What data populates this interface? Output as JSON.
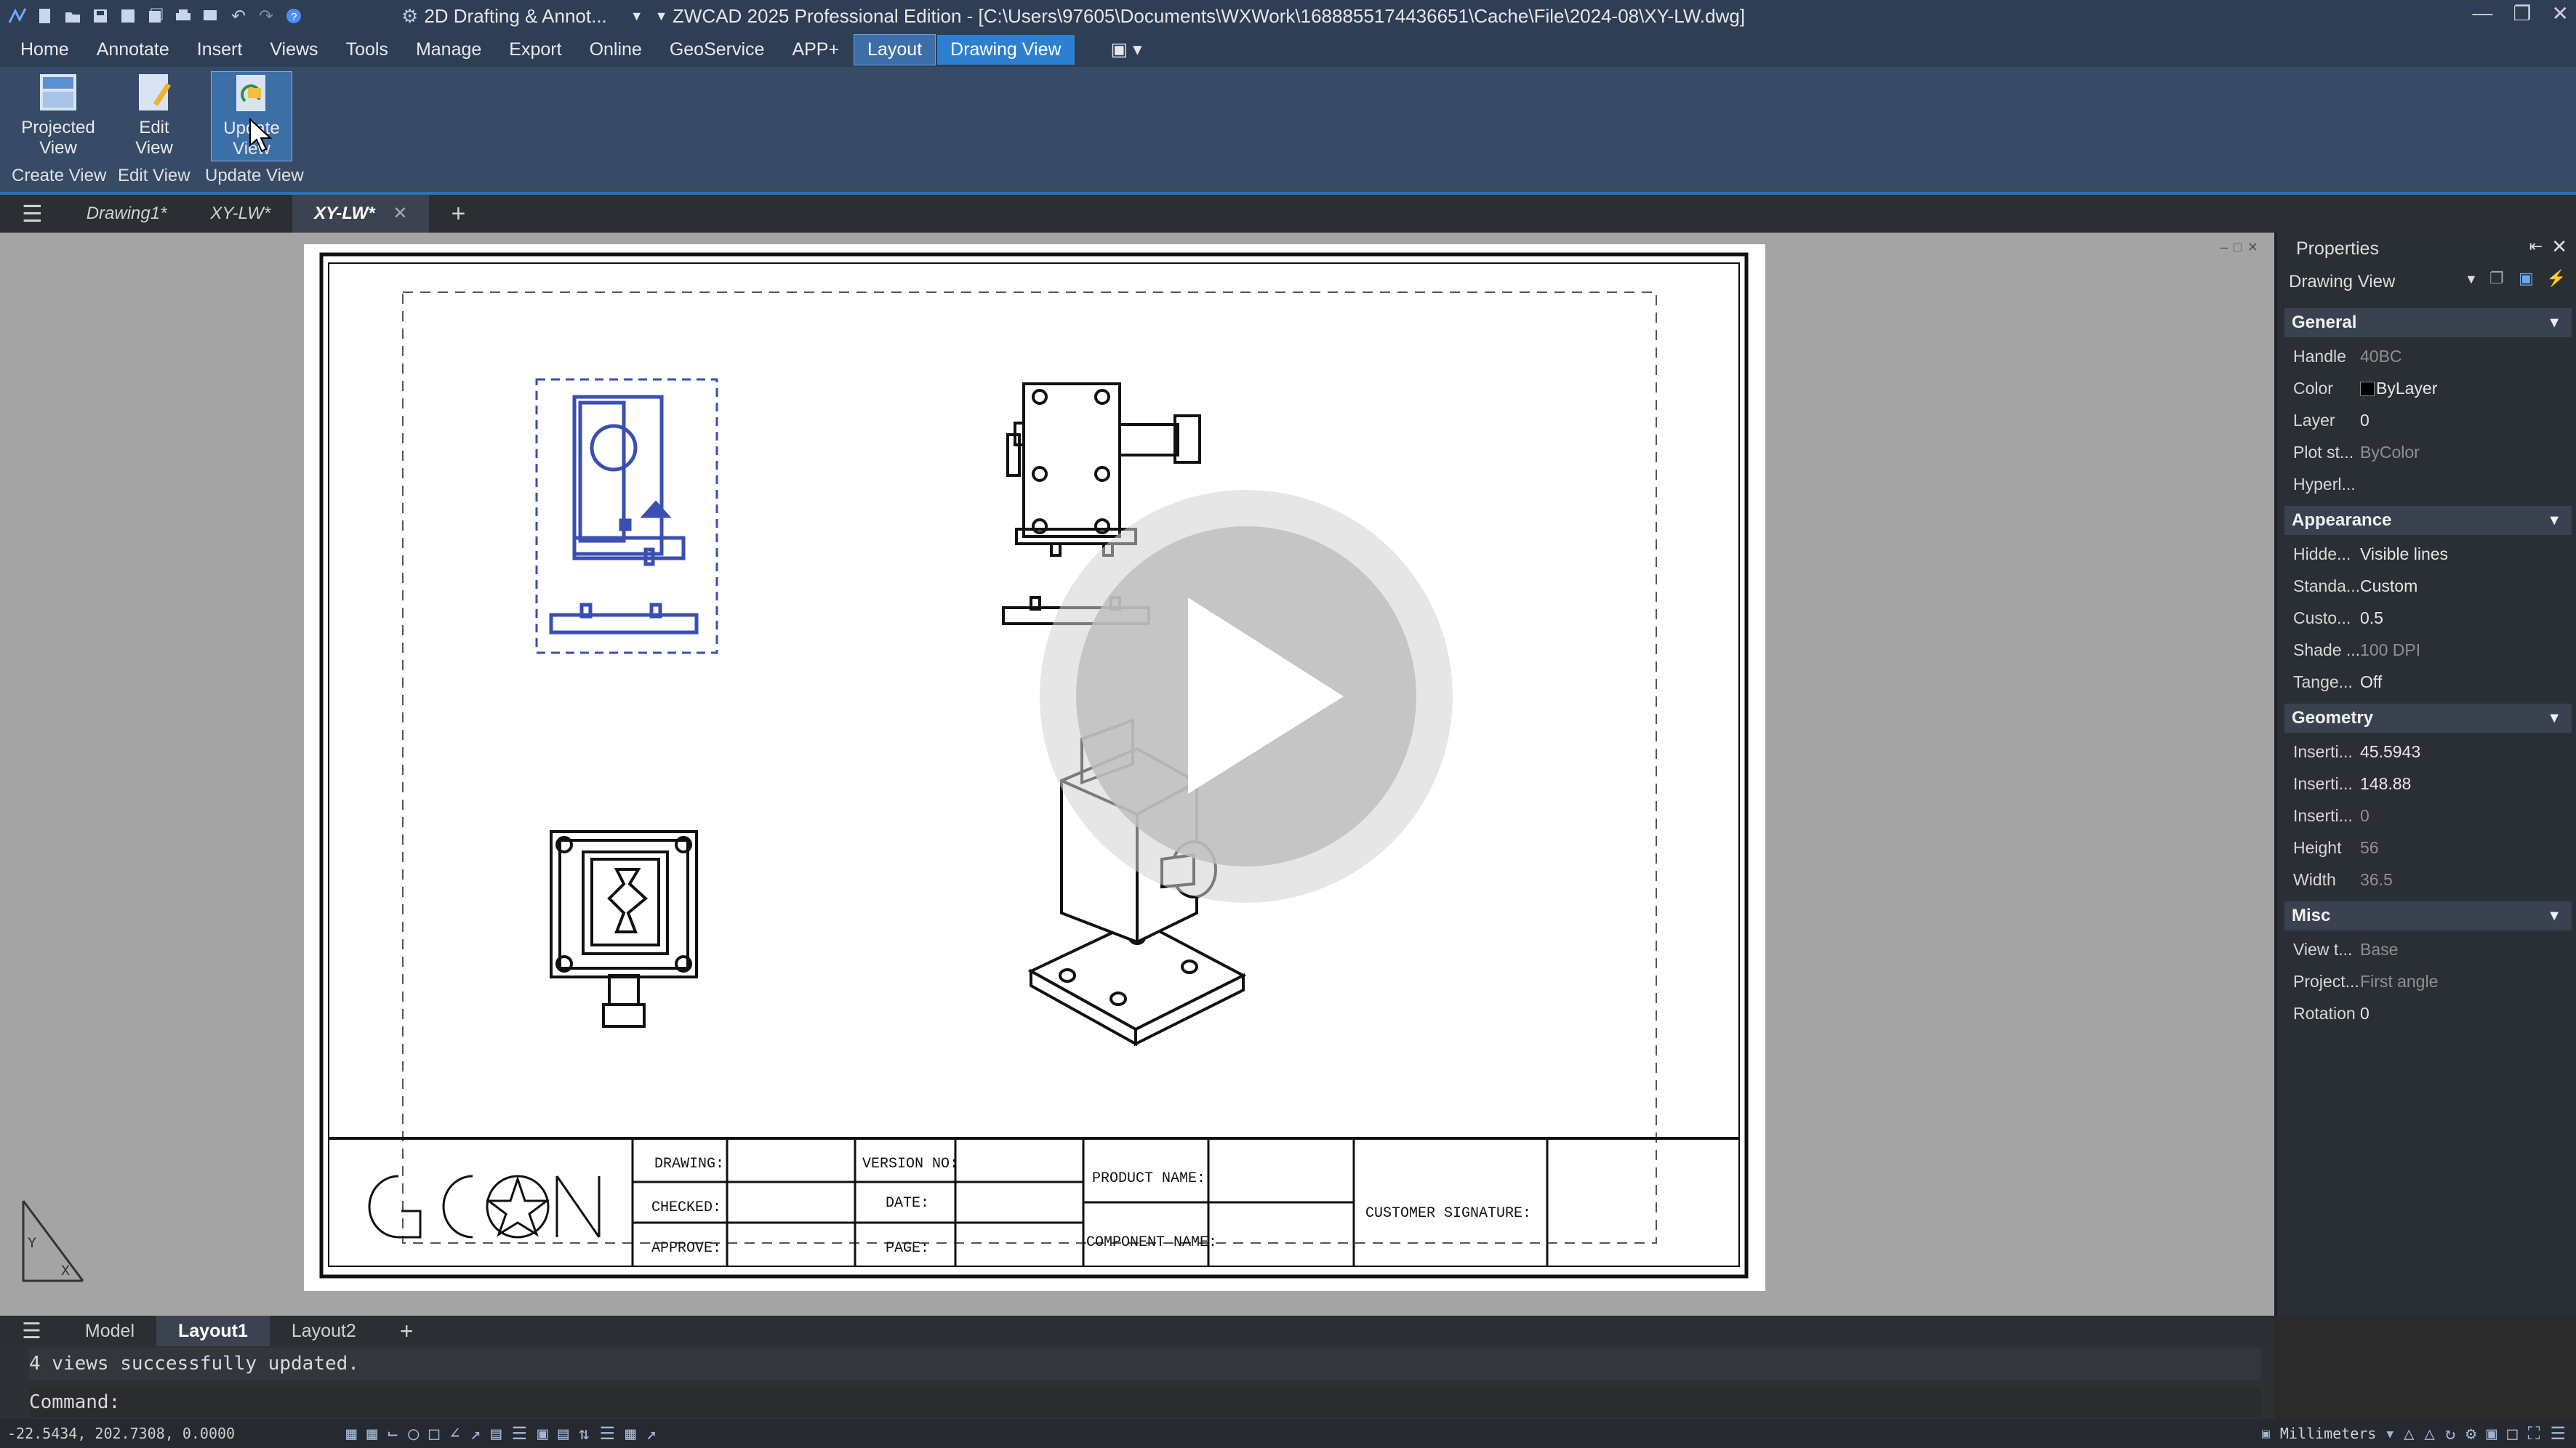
{
  "title_bar": {
    "workspace": "2D Drafting & Annot...",
    "title": "ZWCAD 2025 Professional Edition - [C:\\Users\\97605\\Documents\\WXWork\\1688855174436651\\Cache\\File\\2024-08\\XY-LW.dwg]"
  },
  "menu": [
    "Home",
    "Annotate",
    "Insert",
    "Views",
    "Tools",
    "Manage",
    "Export",
    "Online",
    "GeoService",
    "APP+",
    "Layout",
    "Drawing View"
  ],
  "ribbon": {
    "buttons": [
      {
        "label": "Projected\nView",
        "l1": "Projected",
        "l2": "View"
      },
      {
        "l1": "Edit",
        "l2": "View"
      },
      {
        "l1": "Update",
        "l2": "View"
      }
    ],
    "groups": [
      "Create View",
      "Edit View",
      "Update View"
    ]
  },
  "doc_tabs": [
    "Drawing1*",
    "XY-LW*",
    "XY-LW*"
  ],
  "title_block": {
    "logo": "GCON",
    "drawing": "DRAWING:",
    "checked": "CHECKED:",
    "approve": "APPROVE:",
    "version": "VERSION NO:",
    "date": "DATE:",
    "page": "PAGE:",
    "product": "PRODUCT NAME:",
    "component": "COMPONENT NAME:",
    "customer": "CUSTOMER SIGNATURE:"
  },
  "properties": {
    "title": "Properties",
    "selector": "Drawing View",
    "sections": {
      "general": "General",
      "appearance": "Appearance",
      "geometry": "Geometry",
      "misc": "Misc"
    },
    "general": [
      {
        "k": "Handle",
        "v": "40BC"
      },
      {
        "k": "Color",
        "v": "ByLayer"
      },
      {
        "k": "Layer",
        "v": "0"
      },
      {
        "k": "Plot st...",
        "v": "ByColor"
      },
      {
        "k": "Hyperl...",
        "v": ""
      }
    ],
    "appearance": [
      {
        "k": "Hidde...",
        "v": "Visible lines"
      },
      {
        "k": "Standa...",
        "v": "Custom"
      },
      {
        "k": "Custo...",
        "v": "0.5"
      },
      {
        "k": "Shade ...",
        "v": "100  DPI"
      },
      {
        "k": "Tange...",
        "v": "Off"
      }
    ],
    "geometry": [
      {
        "k": "Inserti...",
        "v": "45.5943"
      },
      {
        "k": "Inserti...",
        "v": "148.88"
      },
      {
        "k": "Inserti...",
        "v": "0"
      },
      {
        "k": "Height",
        "v": "56"
      },
      {
        "k": "Width",
        "v": "36.5"
      }
    ],
    "misc": [
      {
        "k": "View t...",
        "v": "Base"
      },
      {
        "k": "Project...",
        "v": "First angle"
      },
      {
        "k": "Rotation",
        "v": "0"
      }
    ]
  },
  "layout_tabs": [
    "Model",
    "Layout1",
    "Layout2"
  ],
  "command": {
    "history": "4 views successfully updated.",
    "prompt": "Command:"
  },
  "status": {
    "coords": "-22.5434, 202.7308, 0.0000",
    "units": "Millimeters"
  },
  "colors": {
    "accent": "#2f7fd0",
    "selection_blue": "#3a4fb0"
  }
}
